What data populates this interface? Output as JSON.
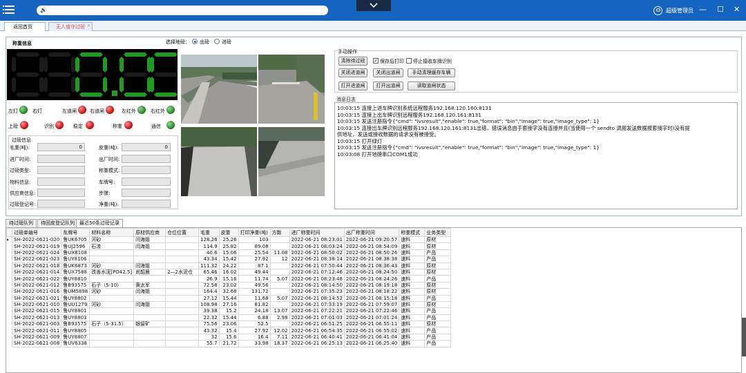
{
  "header": {
    "user": "超级管理员",
    "icons": [
      "menu-icon",
      "volume-icon",
      "chevron-down-icon",
      "user-icon",
      "minimize-icon",
      "maximize-icon",
      "close-icon"
    ]
  },
  "page_tabs": [
    {
      "label": "返回首页",
      "active": false
    },
    {
      "label": "无人值守过磅",
      "active": true
    }
  ],
  "weigh": {
    "section_title": "称重信息",
    "display": "0.00",
    "select_label": "选择地磅：",
    "radio": [
      {
        "label": "出磅",
        "checked": true
      },
      {
        "label": "进磅",
        "checked": false
      }
    ]
  },
  "lights": {
    "row1": [
      {
        "label": "左灯",
        "color": "#2e8b2e"
      },
      {
        "label": "右灯",
        "color": "#2e8b2e"
      },
      {
        "label": "左道闸",
        "color": "#c81818"
      },
      {
        "label": "右道闸",
        "color": "#c81818"
      },
      {
        "label": "左红外",
        "color": "#2e8b2e"
      },
      {
        "label": "右红外",
        "color": "#2e8b2e"
      }
    ],
    "row2": [
      {
        "label": "上磅",
        "color": "#c81818"
      },
      {
        "label": "识别",
        "color": "#c81818"
      },
      {
        "label": "稳定",
        "color": "#c81818"
      },
      {
        "label": "称重",
        "color": "#c81818"
      },
      {
        "label": "通信",
        "color": "#2e8b2e"
      }
    ]
  },
  "pass_info": {
    "title": "过磅信息",
    "fields": [
      {
        "label": "毛重(吨):",
        "value": "0"
      },
      {
        "label": "皮重(吨):",
        "value": "0"
      },
      {
        "label": "进厂时间:",
        "value": ""
      },
      {
        "label": "出厂时间:",
        "value": ""
      },
      {
        "label": "过磅类型:",
        "value": ""
      },
      {
        "label": "称重模式:",
        "value": ""
      },
      {
        "label": "物料信息:",
        "value": ""
      },
      {
        "label": "车牌号:",
        "value": ""
      },
      {
        "label": "供应商信息:",
        "value": ""
      },
      {
        "label": "步骤:",
        "value": ""
      },
      {
        "label": "过磅登记号:",
        "value": ""
      },
      {
        "label": "净重(吨):",
        "value": ""
      }
    ]
  },
  "manual": {
    "title": "手动操作",
    "buttons_row1": [
      "清除待过磅"
    ],
    "checkboxes": [
      {
        "label": "保存后打印",
        "checked": true
      },
      {
        "label": "停止接收车牌识别",
        "checked": false
      }
    ],
    "buttons_row2": [
      "关闭进道闸",
      "关闭出道闸",
      "手动清理缓存车辆"
    ],
    "buttons_row3": [
      "打开进道闸",
      "打开出道闸",
      "读取道闸状态"
    ]
  },
  "log": {
    "title": "消息日志",
    "lines": [
      "10:03:15 连接上进车牌识别系统远程服务192.168.120.160:8131",
      "10:03:15 连接上出车牌识别远程服务192.168.120.161:8131",
      "10:03:15 发送注册指令{\"cmd\": \"ivsresult\",\"enable\": true,\"format\": \"bin\",\"image\": true,\"image_type\": 1}",
      "10:03:15 连接出车牌识别远程服务192.168.120.161:8131出错，错误消息由于套接字没有连接并且(当使用一个 sendto 调用发送数据报套接字时)没有提",
      "供地址，发送或接收数据的请求没有被接受。",
      "10:03:15 打开绿灯",
      "10:03:15 发送注册指令{\"cmd\": \"ivsresult\",\"enable\": true,\"format\": \"bin\",\"image\": true,\"image_type\": 1}",
      "10:03:08 打开地磅串口COM1成功"
    ]
  },
  "grid_tabs": [
    {
      "label": "待过磅队列",
      "active": false
    },
    {
      "label": "待回皮登记队列",
      "active": false
    },
    {
      "label": "最近50条过磅记录",
      "active": true
    }
  ],
  "grid": {
    "columns": [
      "过磅单编号",
      "车牌号",
      "材料名称",
      "原材供应商",
      "仓位位置",
      "毛重",
      "皮重",
      "打印净重(吨)",
      "方数",
      "进厂称重时间",
      "出厂称重时间",
      "称重模式",
      "业务类型"
    ],
    "rows": [
      [
        "SH-2022-0621-020",
        "鲁UK6705",
        "河砂",
        "闫海姐",
        "",
        "128.26",
        "25.26",
        "103",
        "",
        "2022-06-21 08:23:01",
        "2022-06-21 09:20:57",
        "速料",
        "原材"
      ],
      [
        "SH-2022-0621-019",
        "鲁UJ2596",
        "石渣",
        "闫海姐",
        "",
        "114.9",
        "25.82",
        "89.08",
        "",
        "2022-06-21 08:03:24",
        "2022-06-21 08:54:09",
        "速料",
        "原材"
      ],
      [
        "SH-2022-0621-024",
        "鲁UX8108",
        "",
        "",
        "",
        "40.6",
        "15.06",
        "25.54",
        "11.08",
        "2022-06-21 08:50:02",
        "2022-06-21 08:50:26",
        "速料",
        "产品"
      ],
      [
        "SH-2022-0621-023",
        "鲁UY8106",
        "",
        "",
        "",
        "43.34",
        "15.42",
        "27.92",
        "12",
        "2022-06-21 08:38:14",
        "2022-06-21 08:38:38",
        "速料",
        "产品"
      ],
      [
        "SH-2022-0621-018",
        "鲁UK6873",
        "河砂",
        "闫海姐",
        "",
        "111.32",
        "24.22",
        "87.1",
        "",
        "2022-06-21 07:50:44",
        "2022-06-21 08:36:43",
        "速料",
        "原材"
      ],
      [
        "SH-2022-0621-014",
        "鲁UX7588",
        "改善水泥[PO42.5]",
        "尚韶晨",
        "2—2水泥仓",
        "65.46",
        "16.02",
        "49.44",
        "",
        "2022-06-21 07:12:46",
        "2022-06-21 08:24:50",
        "速料",
        "原材"
      ],
      [
        "SH-2022-0621-022",
        "鲁UY8810",
        "",
        "",
        "",
        "26.9",
        "15.16",
        "11.74",
        "5.07",
        "2022-06-21 08:23:48",
        "2022-06-21 08:24:26",
        "速料",
        "产品"
      ],
      [
        "SH-2022-0621-012",
        "鲁B93575",
        "石子（5-10）",
        "黄太军",
        "",
        "72.58",
        "23.02",
        "49.56",
        "",
        "2022-06-21 08:14:50",
        "2022-06-21 08:19:18",
        "速料",
        "原材"
      ],
      [
        "SH-2022-0621-016",
        "鲁UM5898",
        "河砂",
        "闫海姐",
        "",
        "164.4",
        "32.68",
        "131.72",
        "",
        "2022-06-21 07:35:23",
        "2022-06-21 08:18:22",
        "速料",
        "原材"
      ],
      [
        "SH-2022-0621-021",
        "鲁UY8802",
        "",
        "",
        "",
        "27.12",
        "15.44",
        "11.68",
        "5.07",
        "2022-06-21 08:14:52",
        "2022-06-21 08:15:18",
        "速料",
        "产品"
      ],
      [
        "SH-2022-0621-010",
        "鲁UU1279",
        "河砂",
        "闫海姐",
        "",
        "108.98",
        "27.16",
        "81.82",
        "",
        "2022-06-21 07:33:19",
        "2022-06-21 07:59:07",
        "速料",
        "原材"
      ],
      [
        "SH-2022-0621-015",
        "鲁UY8801",
        "",
        "",
        "",
        "39.38",
        "15.2",
        "24.18",
        "13.07",
        "2022-06-21 07:22:21",
        "2022-06-21 07:22:46",
        "速料",
        "产品"
      ],
      [
        "SH-2022-0621-013",
        "鲁UY8803",
        "",
        "",
        "",
        "22.32",
        "15.44",
        "6.88",
        "2.98",
        "2022-06-21 07:01:03",
        "2022-06-21 07:01:24",
        "速料",
        "产品"
      ],
      [
        "SH-2022-0621-003",
        "鲁B93575",
        "石子（5-31.5）",
        "银留矿",
        "",
        "75.56",
        "23.06",
        "52.5",
        "",
        "2022-06-21 06:51:25",
        "2022-06-21 06:55:11",
        "速料",
        "原材"
      ],
      [
        "SH-2022-0621-011",
        "鲁UY8805",
        "",
        "",
        "",
        "43.32",
        "15.4",
        "27.92",
        "12.02",
        "2022-06-21 06:54:35",
        "2022-06-21 06:55:02",
        "速料",
        "产品"
      ],
      [
        "SH-2022-0621-009",
        "鲁UY8807",
        "",
        "",
        "",
        "32",
        "15.6",
        "16.4",
        "7.11",
        "2022-06-21 06:40:41",
        "2022-06-21 06:41:04",
        "速料",
        "产品"
      ],
      [
        "SH-2022-0621-008",
        "鲁UV6338",
        "",
        "",
        "",
        "55.7",
        "21.72",
        "33.98",
        "18.37",
        "2022-06-21 06:25:13",
        "2022-06-21 06:25:40",
        "速料",
        "产品"
      ]
    ]
  }
}
